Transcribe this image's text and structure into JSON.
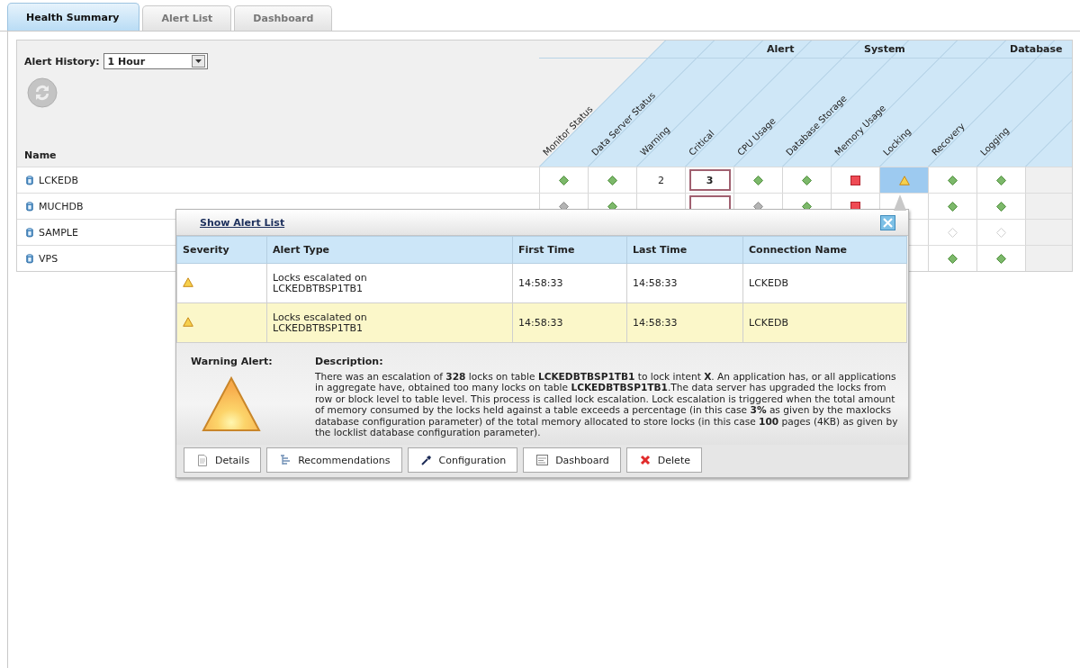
{
  "tabs": [
    {
      "label": "Health Summary",
      "selected": true
    },
    {
      "label": "Alert List",
      "selected": false
    },
    {
      "label": "Dashboard",
      "selected": false
    }
  ],
  "alert_history": {
    "label": "Alert History:",
    "value": "1 Hour"
  },
  "grid": {
    "name_header": "Name",
    "columns": [
      {
        "label": "Monitor Status"
      },
      {
        "label": "Data Server Status"
      },
      {
        "label": "Warning",
        "group": "Alert"
      },
      {
        "label": "Critical"
      },
      {
        "label": "CPU Usage",
        "group": "System"
      },
      {
        "label": "Database Storage"
      },
      {
        "label": "Memory Usage"
      },
      {
        "label": "Locking",
        "group": "Database"
      },
      {
        "label": "Recovery"
      },
      {
        "label": "Logging"
      }
    ],
    "rows": [
      {
        "name": "LCKEDB",
        "cells": [
          {
            "kind": "ok",
            "selected": false
          },
          {
            "kind": "ok",
            "selected": false
          },
          {
            "kind": "count",
            "text": "2",
            "selected": false
          },
          {
            "kind": "critical",
            "text": "3",
            "selected": false
          },
          {
            "kind": "ok",
            "selected": false
          },
          {
            "kind": "ok",
            "selected": false
          },
          {
            "kind": "error",
            "selected": false
          },
          {
            "kind": "warning",
            "selected": true
          },
          {
            "kind": "ok",
            "selected": false
          },
          {
            "kind": "ok",
            "selected": false
          }
        ]
      },
      {
        "name": "MUCHDB",
        "cells": [
          {
            "kind": "unknown",
            "selected": false
          },
          {
            "kind": "ok",
            "selected": false
          },
          {
            "kind": "count",
            "selected": false
          },
          {
            "kind": "critical",
            "selected": false
          },
          {
            "kind": "unknown",
            "selected": false
          },
          {
            "kind": "ok",
            "selected": false
          },
          {
            "kind": "error",
            "selected": false
          },
          {
            "kind": "covered",
            "selected": false
          },
          {
            "kind": "ok",
            "selected": false
          },
          {
            "kind": "ok",
            "selected": false
          }
        ]
      },
      {
        "name": "SAMPLE",
        "cells": [
          {
            "kind": "covered"
          },
          {
            "kind": "covered"
          },
          {
            "kind": "covered"
          },
          {
            "kind": "covered"
          },
          {
            "kind": "covered"
          },
          {
            "kind": "covered"
          },
          {
            "kind": "covered"
          },
          {
            "kind": "covered"
          },
          {
            "kind": "inactive",
            "selected": false
          },
          {
            "kind": "inactive",
            "selected": false
          }
        ]
      },
      {
        "name": "VPS",
        "cells": [
          {
            "kind": "covered"
          },
          {
            "kind": "covered"
          },
          {
            "kind": "covered"
          },
          {
            "kind": "covered"
          },
          {
            "kind": "covered"
          },
          {
            "kind": "covered"
          },
          {
            "kind": "covered"
          },
          {
            "kind": "covered"
          },
          {
            "kind": "ok",
            "selected": false
          },
          {
            "kind": "ok",
            "selected": false
          }
        ]
      }
    ]
  },
  "popup": {
    "title": "Show Alert List",
    "columns": [
      "Severity",
      "Alert Type",
      "First Time",
      "Last Time",
      "Connection Name"
    ],
    "rows": [
      {
        "kind": "warning",
        "alert_type": "Locks escalated on LCKEDBTBSP1TB1",
        "first_time": "14:58:33",
        "last_time": "14:58:33",
        "connection": "LCKEDB",
        "selected": false
      },
      {
        "kind": "warning",
        "alert_type": "Locks escalated on LCKEDBTBSP1TB1",
        "first_time": "14:58:33",
        "last_time": "14:58:33",
        "connection": "LCKEDB",
        "selected": true
      }
    ],
    "detail": {
      "heading": "Warning Alert:",
      "kind": "warning",
      "description_label": "Description:",
      "description": "There was an escalation of **328** locks on table **LCKEDBTBSP1TB1** to lock intent **X**. An application has, or all applications in aggregate have, obtained too many locks on table **LCKEDBTBSP1TB1**.The data server has upgraded the locks from row or block level to table level. This process is called lock escalation. Lock escalation is triggered when the total amount of memory consumed by the locks held against a table exceeds a percentage (in this case **3%** as given by the maxlocks database configuration parameter) of the total memory allocated to store locks (in this case **100** pages (4KB) as given by the locklist database configuration parameter)."
    },
    "buttons": [
      {
        "label": "Details",
        "kind": "details"
      },
      {
        "label": "Recommendations",
        "kind": "recommendations"
      },
      {
        "label": "Configuration",
        "kind": "configuration"
      },
      {
        "label": "Dashboard",
        "kind": "dashboard"
      },
      {
        "label": "Delete",
        "kind": "delete"
      }
    ]
  }
}
